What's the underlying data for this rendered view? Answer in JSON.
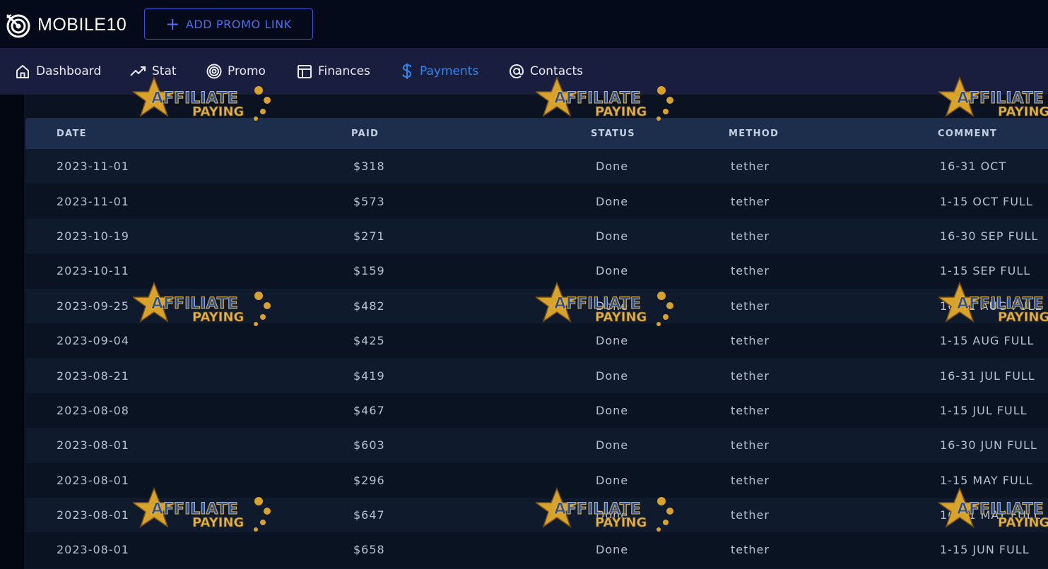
{
  "header": {
    "logo_text": "MOBILE10",
    "add_promo_label": "ADD PROMO LINK"
  },
  "nav": {
    "items": [
      {
        "label": "Dashboard",
        "icon": "home-icon"
      },
      {
        "label": "Stat",
        "icon": "trending-up-icon"
      },
      {
        "label": "Promo",
        "icon": "target-icon"
      },
      {
        "label": "Finances",
        "icon": "layout-icon"
      },
      {
        "label": "Payments",
        "icon": "dollar-icon"
      },
      {
        "label": "Contacts",
        "icon": "at-icon"
      }
    ],
    "active": "Payments"
  },
  "table": {
    "columns": [
      "DATE",
      "PAID",
      "STATUS",
      "METHOD",
      "COMMENT"
    ],
    "rows": [
      {
        "date": "2023-11-01",
        "paid": "$318",
        "status": "Done",
        "method": "tether",
        "comment": "16-31 OCT"
      },
      {
        "date": "2023-11-01",
        "paid": "$573",
        "status": "Done",
        "method": "tether",
        "comment": "1-15 OCT FULL"
      },
      {
        "date": "2023-10-19",
        "paid": "$271",
        "status": "Done",
        "method": "tether",
        "comment": "16-30 SEP FULL"
      },
      {
        "date": "2023-10-11",
        "paid": "$159",
        "status": "Done",
        "method": "tether",
        "comment": "1-15 SEP FULL"
      },
      {
        "date": "2023-09-25",
        "paid": "$482",
        "status": "Done",
        "method": "tether",
        "comment": "16-31 AUG FULL"
      },
      {
        "date": "2023-09-04",
        "paid": "$425",
        "status": "Done",
        "method": "tether",
        "comment": "1-15 AUG FULL"
      },
      {
        "date": "2023-08-21",
        "paid": "$419",
        "status": "Done",
        "method": "tether",
        "comment": "16-31 JUL FULL"
      },
      {
        "date": "2023-08-08",
        "paid": "$467",
        "status": "Done",
        "method": "tether",
        "comment": "1-15 JUL FULL"
      },
      {
        "date": "2023-08-01",
        "paid": "$603",
        "status": "Done",
        "method": "tether",
        "comment": "16-30 JUN FULL"
      },
      {
        "date": "2023-08-01",
        "paid": "$296",
        "status": "Done",
        "method": "tether",
        "comment": "1-15 MAY FULL"
      },
      {
        "date": "2023-08-01",
        "paid": "$647",
        "status": "Done",
        "method": "tether",
        "comment": "16-31 MAY FULL"
      },
      {
        "date": "2023-08-01",
        "paid": "$658",
        "status": "Done",
        "method": "tether",
        "comment": "1-15 JUN FULL"
      }
    ]
  },
  "watermark": {
    "line1": "AFFILIATE",
    "line2": "PAYING"
  },
  "colors": {
    "accent": "#2d86f0",
    "button_border": "#3a55d6",
    "nav_bg": "#1a1e3e",
    "table_header_bg": "#1c2e4c"
  }
}
